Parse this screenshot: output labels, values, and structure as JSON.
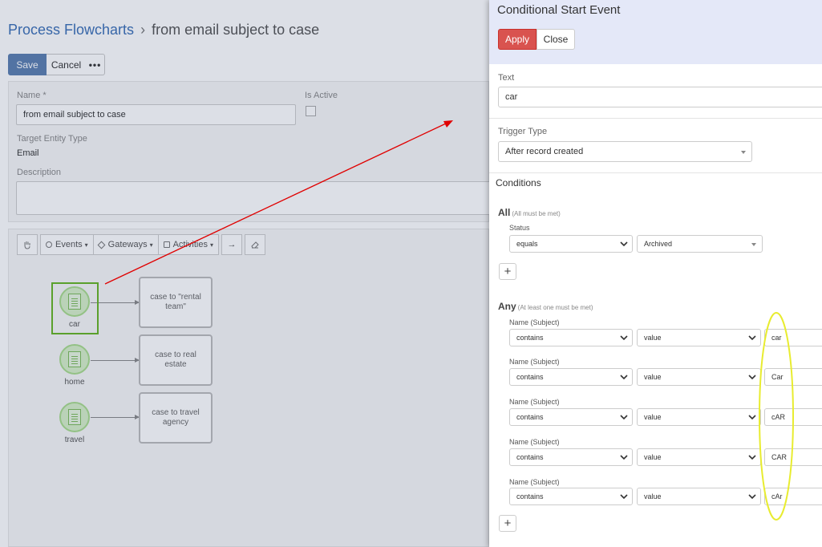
{
  "breadcrumb": {
    "root": "Process Flowcharts",
    "separator": "›",
    "current": "from email subject to case"
  },
  "actions": {
    "save": "Save",
    "cancel": "Cancel",
    "more": "•••"
  },
  "form": {
    "name_label": "Name *",
    "name_value": "from email subject to case",
    "is_active_label": "Is Active",
    "target_entity_label": "Target Entity Type",
    "target_entity_value": "Email",
    "description_label": "Description"
  },
  "diagram_toolbar": {
    "events": "Events",
    "gateways": "Gateways",
    "activities": "Activities"
  },
  "diagram": {
    "nodes": [
      {
        "label": "car",
        "task": "case to \"rental team\""
      },
      {
        "label": "home",
        "task": "case to real estate"
      },
      {
        "label": "travel",
        "task": "case to travel agency"
      }
    ]
  },
  "panel": {
    "title": "Conditional Start Event",
    "apply": "Apply",
    "close": "Close",
    "text_label": "Text",
    "text_value": "car",
    "trigger_label": "Trigger Type",
    "trigger_value": "After record created",
    "conditions_title": "Conditions",
    "all_title": "All",
    "all_sub": "(All must be met)",
    "status_label": "Status",
    "status_operator": "equals",
    "status_value": "Archived",
    "any_title": "Any",
    "any_sub": "(At least one must be met)",
    "add": "+",
    "any_conditions": [
      {
        "label": "Name (Subject)",
        "operator": "contains",
        "type": "value",
        "value": "car"
      },
      {
        "label": "Name (Subject)",
        "operator": "contains",
        "type": "value",
        "value": "Car"
      },
      {
        "label": "Name (Subject)",
        "operator": "contains",
        "type": "value",
        "value": "cAR"
      },
      {
        "label": "Name (Subject)",
        "operator": "contains",
        "type": "value",
        "value": "CAR"
      },
      {
        "label": "Name (Subject)",
        "operator": "contains",
        "type": "value",
        "value": "cAr"
      }
    ]
  },
  "colors": {
    "apply": "#d9534f",
    "save": "#5b7fb0",
    "header": "#e4e8f8",
    "highlight_green": "#5aa02c",
    "annotation_red": "#e00000",
    "annotation_yellow": "#e8ec30"
  }
}
